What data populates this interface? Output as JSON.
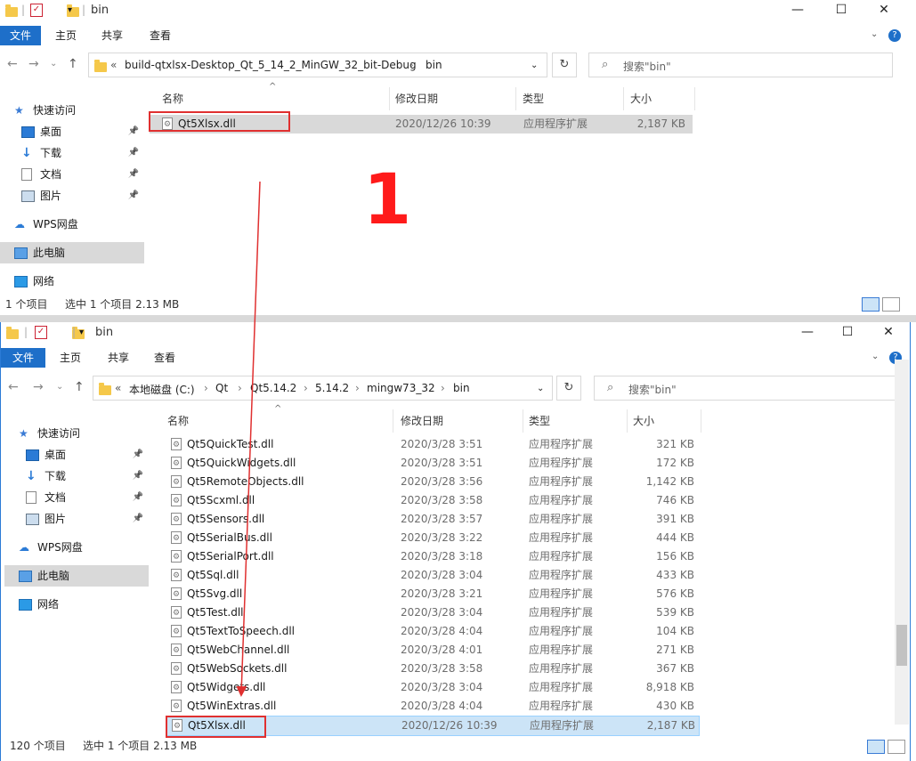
{
  "w1": {
    "title": "bin",
    "ribbon": {
      "file": "文件",
      "home": "主页",
      "share": "共享",
      "view": "查看"
    },
    "address": {
      "overflow": "«",
      "path": [
        "build-qtxlsx-Desktop_Qt_5_14_2_MinGW_32_bit-Debug",
        "bin"
      ]
    },
    "search_placeholder": "搜索\"bin\"",
    "nav": [
      {
        "label": "快速访问",
        "icon": "star-icon"
      },
      {
        "label": "桌面",
        "icon": "desktop-icon",
        "pinned": true
      },
      {
        "label": "下载",
        "icon": "download-icon",
        "pinned": true
      },
      {
        "label": "文档",
        "icon": "document-icon",
        "pinned": true
      },
      {
        "label": "图片",
        "icon": "pictures-icon",
        "pinned": true
      },
      {
        "label": "WPS网盘",
        "icon": "cloud-icon"
      },
      {
        "label": "此电脑",
        "icon": "pc-icon",
        "selected": true
      },
      {
        "label": "网络",
        "icon": "network-icon"
      }
    ],
    "columns": {
      "name": "名称",
      "date": "修改日期",
      "type": "类型",
      "size": "大小"
    },
    "files": [
      {
        "name": "Qt5Xlsx.dll",
        "date": "2020/12/26 10:39",
        "type": "应用程序扩展",
        "size": "2,187 KB",
        "selected": true
      }
    ],
    "status": {
      "count": "1 个项目",
      "selected": "选中 1 个项目  2.13 MB"
    }
  },
  "w2": {
    "title": "bin",
    "ribbon": {
      "file": "文件",
      "home": "主页",
      "share": "共享",
      "view": "查看"
    },
    "address": {
      "overflow": "«",
      "path": [
        "本地磁盘 (C:)",
        "Qt",
        "Qt5.14.2",
        "5.14.2",
        "mingw73_32",
        "bin"
      ]
    },
    "search_placeholder": "搜索\"bin\"",
    "nav": [
      {
        "label": "快速访问",
        "icon": "star-icon"
      },
      {
        "label": "桌面",
        "icon": "desktop-icon",
        "pinned": true
      },
      {
        "label": "下载",
        "icon": "download-icon",
        "pinned": true
      },
      {
        "label": "文档",
        "icon": "document-icon",
        "pinned": true
      },
      {
        "label": "图片",
        "icon": "pictures-icon",
        "pinned": true
      },
      {
        "label": "WPS网盘",
        "icon": "cloud-icon"
      },
      {
        "label": "此电脑",
        "icon": "pc-icon",
        "selected": true
      },
      {
        "label": "网络",
        "icon": "network-icon"
      }
    ],
    "columns": {
      "name": "名称",
      "date": "修改日期",
      "type": "类型",
      "size": "大小"
    },
    "files": [
      {
        "name": "Qt5QuickTest.dll",
        "date": "2020/3/28 3:51",
        "type": "应用程序扩展",
        "size": "321 KB"
      },
      {
        "name": "Qt5QuickWidgets.dll",
        "date": "2020/3/28 3:51",
        "type": "应用程序扩展",
        "size": "172 KB"
      },
      {
        "name": "Qt5RemoteObjects.dll",
        "date": "2020/3/28 3:56",
        "type": "应用程序扩展",
        "size": "1,142 KB"
      },
      {
        "name": "Qt5Scxml.dll",
        "date": "2020/3/28 3:58",
        "type": "应用程序扩展",
        "size": "746 KB"
      },
      {
        "name": "Qt5Sensors.dll",
        "date": "2020/3/28 3:57",
        "type": "应用程序扩展",
        "size": "391 KB"
      },
      {
        "name": "Qt5SerialBus.dll",
        "date": "2020/3/28 3:22",
        "type": "应用程序扩展",
        "size": "444 KB"
      },
      {
        "name": "Qt5SerialPort.dll",
        "date": "2020/3/28 3:18",
        "type": "应用程序扩展",
        "size": "156 KB"
      },
      {
        "name": "Qt5Sql.dll",
        "date": "2020/3/28 3:04",
        "type": "应用程序扩展",
        "size": "433 KB"
      },
      {
        "name": "Qt5Svg.dll",
        "date": "2020/3/28 3:21",
        "type": "应用程序扩展",
        "size": "576 KB"
      },
      {
        "name": "Qt5Test.dll",
        "date": "2020/3/28 3:04",
        "type": "应用程序扩展",
        "size": "539 KB"
      },
      {
        "name": "Qt5TextToSpeech.dll",
        "date": "2020/3/28 4:04",
        "type": "应用程序扩展",
        "size": "104 KB"
      },
      {
        "name": "Qt5WebChannel.dll",
        "date": "2020/3/28 4:01",
        "type": "应用程序扩展",
        "size": "271 KB"
      },
      {
        "name": "Qt5WebSockets.dll",
        "date": "2020/3/28 3:58",
        "type": "应用程序扩展",
        "size": "367 KB"
      },
      {
        "name": "Qt5Widgets.dll",
        "date": "2020/3/28 3:04",
        "type": "应用程序扩展",
        "size": "8,918 KB"
      },
      {
        "name": "Qt5WinExtras.dll",
        "date": "2020/3/28 4:04",
        "type": "应用程序扩展",
        "size": "430 KB"
      },
      {
        "name": "Qt5Xlsx.dll",
        "date": "2020/12/26 10:39",
        "type": "应用程序扩展",
        "size": "2,187 KB",
        "selected": true
      }
    ],
    "status": {
      "count": "120 个项目",
      "selected": "选中 1 个项目  2.13 MB"
    },
    "scroll_position": 0.82
  },
  "annotation": {
    "label": "1",
    "color": "#ff1a1a"
  },
  "colors": {
    "accent": "#1e6fc9",
    "selection": "#cce4f7",
    "annotation": "#e03030"
  }
}
